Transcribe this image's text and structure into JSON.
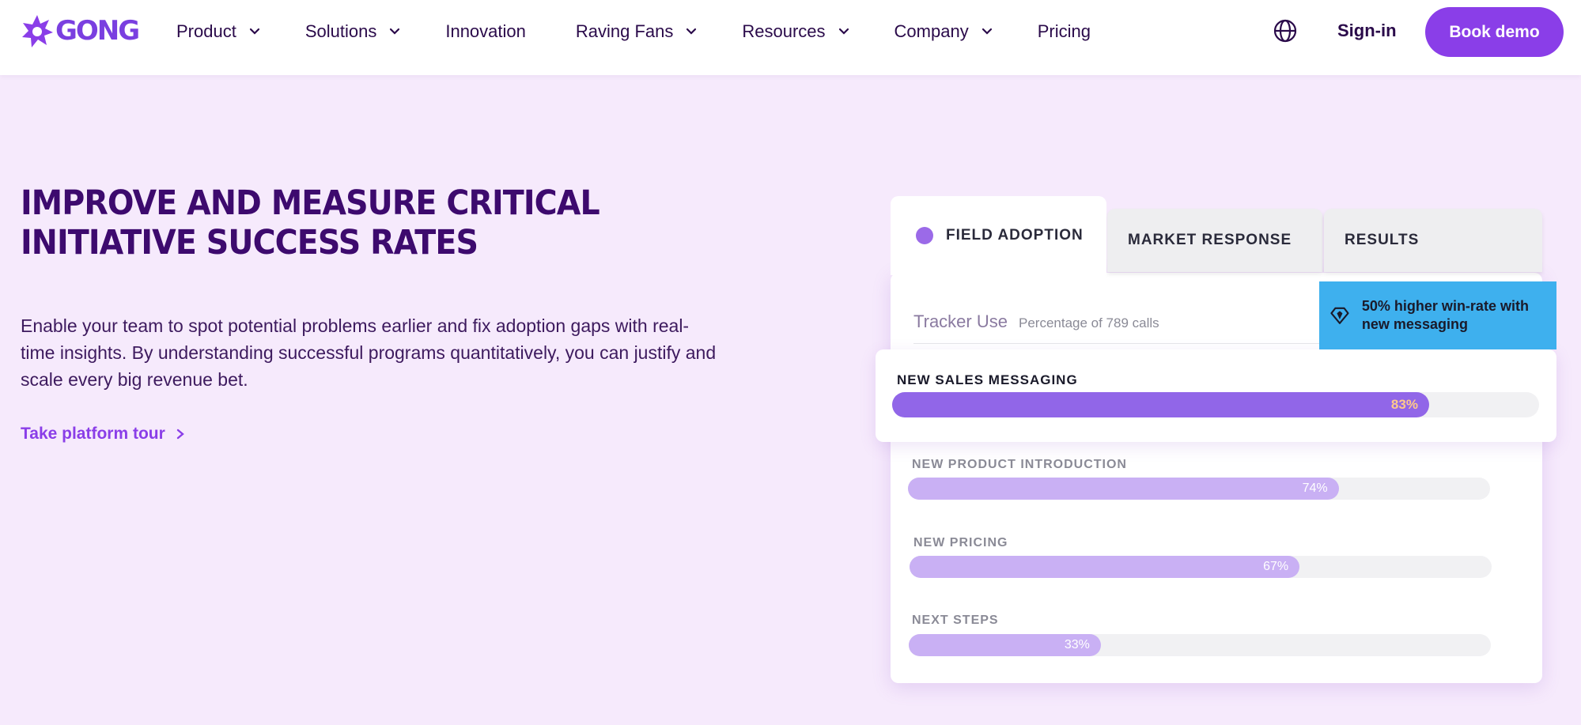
{
  "brand": {
    "name": "GONG",
    "accent": "#8a3ee8"
  },
  "nav": {
    "items": [
      {
        "label": "Product",
        "dropdown": true
      },
      {
        "label": "Solutions",
        "dropdown": true
      },
      {
        "label": "Innovation",
        "dropdown": false
      },
      {
        "label": "Raving Fans",
        "dropdown": true
      },
      {
        "label": "Resources",
        "dropdown": true
      },
      {
        "label": "Company",
        "dropdown": true
      },
      {
        "label": "Pricing",
        "dropdown": false
      }
    ],
    "signin": "Sign-in",
    "cta": "Book demo"
  },
  "hero": {
    "title": "IMPROVE AND MEASURE CRITICAL INITIATIVE SUCCESS RATES",
    "description": "Enable your team to spot potential problems earlier and fix adoption gaps with real-time insights. By understanding successful programs quantitatively, you can justify and scale every big revenue bet.",
    "link": "Take platform tour"
  },
  "card": {
    "tabs": [
      "FIELD ADOPTION",
      "MARKET RESPONSE",
      "RESULTS"
    ],
    "tracker_title": "Tracker Use",
    "tracker_sub": "Percentage of 789 calls",
    "insight": "50% higher win-rate with new messaging",
    "bars": [
      {
        "label": "NEW SALES MESSAGING",
        "value": 83,
        "display": "83%"
      },
      {
        "label": "NEW PRODUCT INTRODUCTION",
        "value": 74,
        "display": "74%"
      },
      {
        "label": "NEW PRICING",
        "value": 67,
        "display": "67%"
      },
      {
        "label": "NEXT STEPS",
        "value": 33,
        "display": "33%"
      }
    ]
  }
}
